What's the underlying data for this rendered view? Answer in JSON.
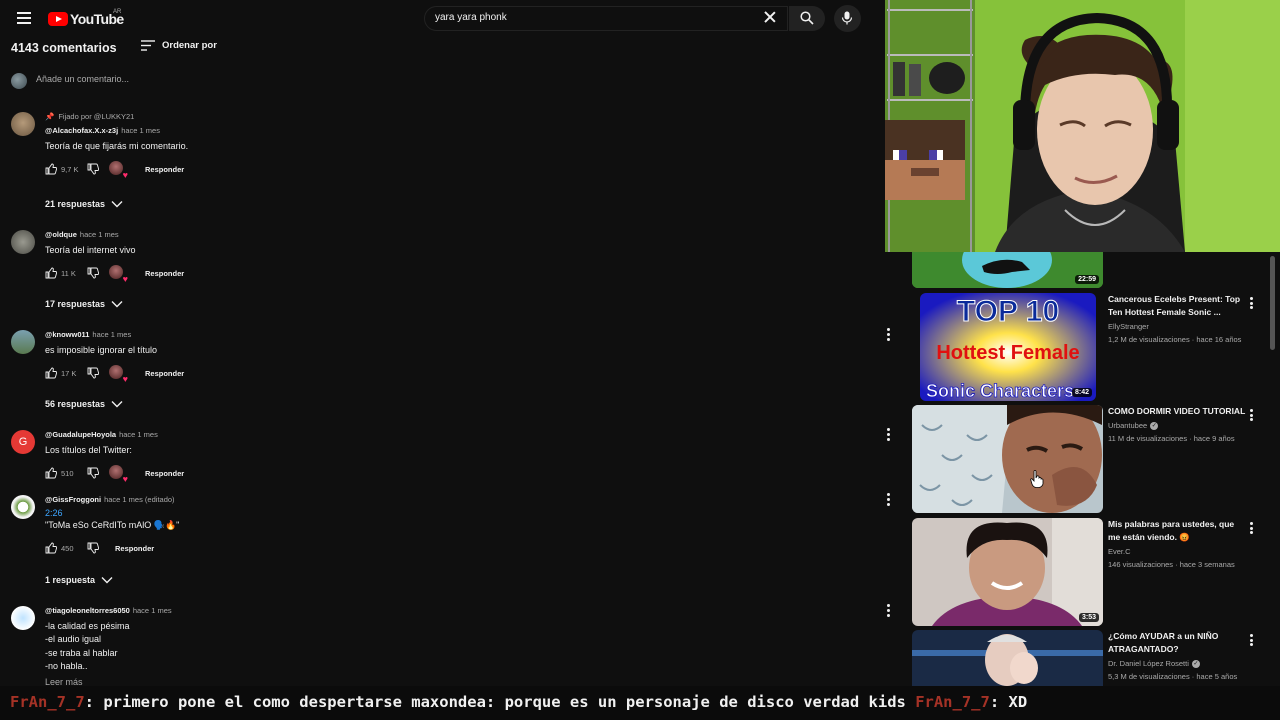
{
  "header": {
    "logo_text": "YouTube",
    "country_code": "AR",
    "search_value": "yara yara phonk"
  },
  "comments_section": {
    "count_label": "4143 comentarios",
    "sort_label": "Ordenar por",
    "add_placeholder": "Añade un comentario..."
  },
  "comments": [
    {
      "pinned_label": "Fijado por @LUKKY21",
      "author": "@Alcachofax.X.x-z3j",
      "time": "hace 1 mes",
      "text": "Teoría de que fijarás mi comentario.",
      "likes": "9,7 K",
      "reply_label": "Responder",
      "replies_label": "21 respuestas"
    },
    {
      "author": "@oldque",
      "time": "hace 1 mes",
      "text": "Teoría del internet vivo",
      "likes": "11 K",
      "reply_label": "Responder",
      "replies_label": "17 respuestas"
    },
    {
      "author": "@knoww011",
      "time": "hace 1 mes",
      "text": "es imposible ignorar el título",
      "likes": "17 K",
      "reply_label": "Responder",
      "replies_label": "56 respuestas"
    },
    {
      "author": "@GuadalupeHoyola",
      "time": "hace 1 mes",
      "text": "Los títulos del Twitter:",
      "likes": "510",
      "reply_label": "Responder",
      "avatar_letter": "G"
    },
    {
      "author": "@GissFroggoni",
      "time": "hace 1 mes (editado)",
      "timestamp_link": "2:26",
      "text": "\"ToMa eSo CeRdITo mAlO 🗣️🔥\"",
      "likes": "450",
      "reply_label": "Responder",
      "replies_label": "1 respuesta"
    },
    {
      "author": "@tiagoleoneltorres6050",
      "time": "hace 1 mes",
      "text": "-la calidad es pésima\n-el audio igual\n-se traba al hablar\n-no habla..",
      "read_more": "Leer más"
    }
  ],
  "recommendations": [
    {
      "duration": "22:59"
    },
    {
      "title": "Cancerous Ecelebs Present: Top Ten Hottest Female Sonic ...",
      "channel": "EllyStranger",
      "meta": "1,2 M de visualizaciones · hace 16 años",
      "duration": "8:42",
      "thumb_top_text": "TOP 10",
      "thumb_mid_text": "Hottest Female",
      "thumb_bottom_text": "Sonic Characters"
    },
    {
      "title": "COMO DORMIR VIDEO TUTORIAL",
      "channel": "Urbantubee",
      "meta": "11 M de visualizaciones · hace 9 años"
    },
    {
      "title": "Mis palabras para ustedes, que me están viendo. 😡",
      "channel": "Ever.C",
      "meta": "146 visualizaciones · hace 3 semanas",
      "duration": "3:53"
    },
    {
      "title": "¿Cómo AYUDAR a un NIÑO ATRAGANTADO?",
      "channel": "Dr. Daniel López Rosetti",
      "meta": "5,3 M de visualizaciones · hace 5 años"
    }
  ],
  "chat": {
    "nick1": "FrAn_7_7",
    "msg1": ": primero pone el como despertarse maxondea: porque es un personaje de disco verdad kids ",
    "nick2": "FrAn_7_7",
    "msg2": ": XD "
  },
  "colors": {
    "background": "#0f0f0f",
    "link_blue": "#3ea6ff",
    "youtube_red": "#ff0000",
    "heart_pink": "#ff2b6b"
  }
}
